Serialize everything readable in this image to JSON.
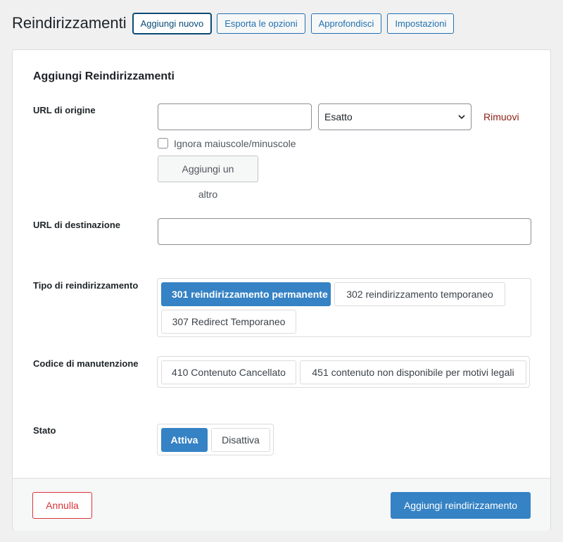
{
  "header": {
    "title": "Reindirizzamenti",
    "buttons": [
      "Aggiungi nuovo",
      "Esporta le opzioni",
      "Approfondisci",
      "Impostazioni"
    ]
  },
  "form": {
    "title": "Aggiungi Reindirizzamenti",
    "source": {
      "label": "URL di origine",
      "value": "",
      "match_selected": "Esatto",
      "remove_label": "Rimuovi",
      "ignore_case_label": "Ignora maiuscole/minuscole",
      "ignore_case_checked": false,
      "add_another_label": "Aggiungi un altro"
    },
    "destination": {
      "label": "URL di destinazione",
      "value": ""
    },
    "redirect_type": {
      "label": "Tipo di reindirizzamento",
      "options": [
        "301 reindirizzamento permanente",
        "302 reindirizzamento temporaneo",
        "307 Redirect Temporaneo"
      ],
      "selected": "301 reindirizzamento permanente"
    },
    "maintenance_code": {
      "label": "Codice di manutenzione",
      "options": [
        "410 Contenuto Cancellato",
        "451 contenuto non disponibile per motivi legali"
      ]
    },
    "status": {
      "label": "Stato",
      "options": [
        "Attiva",
        "Disattiva"
      ],
      "selected": "Attiva"
    }
  },
  "footer": {
    "cancel_label": "Annulla",
    "submit_label": "Aggiungi reindirizzamento"
  },
  "colors": {
    "primary": "#3582c4",
    "cancel": "#d63638",
    "remove_link": "#8a1f11"
  }
}
